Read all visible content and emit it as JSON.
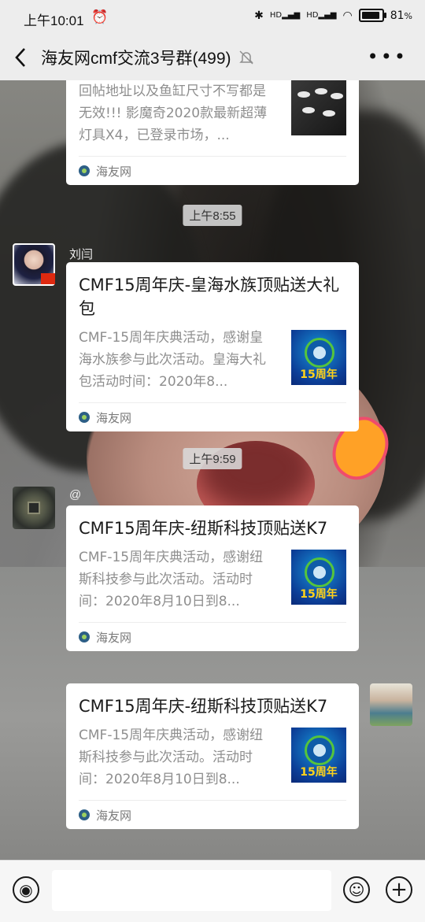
{
  "statusbar": {
    "time": "上午10:01",
    "battery": "81",
    "battery_unit": "%",
    "net_label": "HD"
  },
  "header": {
    "title": "海友网cmf交流3号群(499)"
  },
  "messages": [
    {
      "desc": "回帖地址以及鱼缸尺寸不写都是无效!!! 影魔奇2020款最新超薄灯具X4，已登录市场，...",
      "source": "海友网"
    },
    {
      "time": "上午8:55"
    },
    {
      "sender": "刘闫",
      "title": "CMF15周年庆-皇海水族顶贴送大礼包",
      "desc": "CMF-15周年庆典活动，感谢皇海水族参与此次活动。皇海大礼包活动时间：2020年8...",
      "thumb_text": "15周年",
      "source": "海友网"
    },
    {
      "time": "上午9:59"
    },
    {
      "sender": "@",
      "title": "CMF15周年庆-纽斯科技顶贴送K7",
      "desc": "CMF-15周年庆典活动，感谢纽斯科技参与此次活动。活动时间：2020年8月10日到8...",
      "thumb_text": "15周年",
      "source": "海友网"
    },
    {
      "title": "CMF15周年庆-纽斯科技顶贴送K7",
      "desc": "CMF-15周年庆典活动，感谢纽斯科技参与此次活动。活动时间：2020年8月10日到8...",
      "thumb_text": "15周年",
      "source": "海友网"
    }
  ],
  "icons": [
    "back-arrow-icon",
    "mute-bell-icon",
    "more-icon",
    "voice-icon",
    "emoji-icon",
    "plus-icon",
    "alarm-icon",
    "bluetooth-icon",
    "signal-icon",
    "wifi-icon",
    "battery-icon"
  ],
  "colors": {
    "bar_bg": "#ededed",
    "card_bg": "#ffffff",
    "desc": "#8e8e8e"
  }
}
